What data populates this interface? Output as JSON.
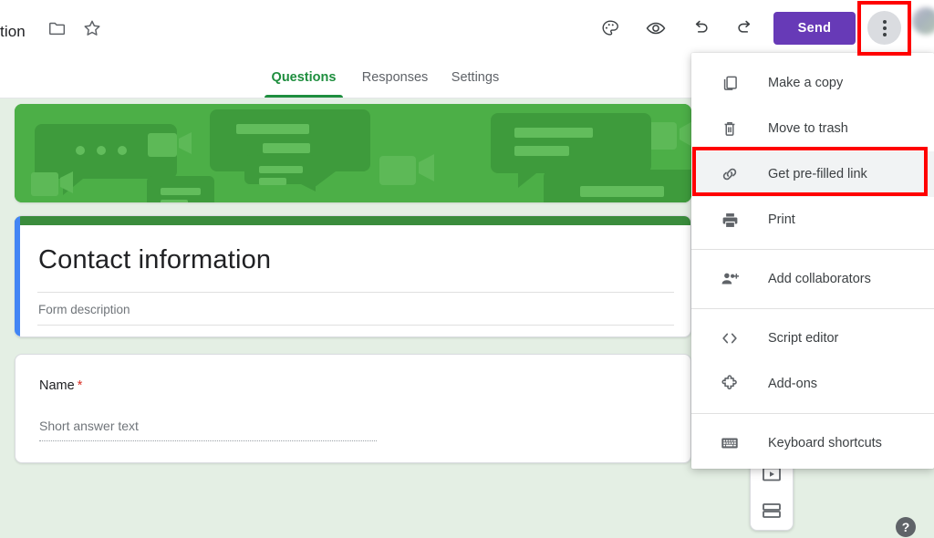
{
  "topbar": {
    "doc_title": "tion",
    "folder_icon": "folder-icon",
    "star_icon": "star-icon",
    "theme_icon": "palette-icon",
    "preview_icon": "eye-icon",
    "undo_icon": "undo-icon",
    "redo_icon": "redo-icon",
    "send_label": "Send",
    "more_icon": "more-vert-icon"
  },
  "tabs": [
    {
      "label": "Questions",
      "active": true
    },
    {
      "label": "Responses",
      "active": false
    },
    {
      "label": "Settings",
      "active": false
    }
  ],
  "form": {
    "title": "Contact information",
    "description_placeholder": "Form description",
    "question": {
      "label": "Name",
      "required_marker": "*",
      "answer_placeholder": "Short answer text"
    }
  },
  "side_toolbar": [
    {
      "icon": "add-video-icon"
    },
    {
      "icon": "add-section-icon"
    }
  ],
  "help": {
    "label": "?"
  },
  "menu": {
    "items": [
      {
        "label": "Make a copy",
        "icon": "copy-icon",
        "highlighted": false,
        "separator_after": false
      },
      {
        "label": "Move to trash",
        "icon": "trash-icon",
        "highlighted": false,
        "separator_after": false
      },
      {
        "label": "Get pre-filled link",
        "icon": "link-icon",
        "highlighted": true,
        "separator_after": false
      },
      {
        "label": "Print",
        "icon": "printer-icon",
        "highlighted": false,
        "separator_after": true
      },
      {
        "label": "Add collaborators",
        "icon": "person-add-icon",
        "highlighted": false,
        "separator_after": true
      },
      {
        "label": "Script editor",
        "icon": "code-icon",
        "highlighted": false,
        "separator_after": false
      },
      {
        "label": "Add-ons",
        "icon": "puzzle-icon",
        "highlighted": false,
        "separator_after": true
      },
      {
        "label": "Keyboard shortcuts",
        "icon": "keyboard-icon",
        "highlighted": false,
        "separator_after": false
      }
    ]
  },
  "colors": {
    "accent_green": "#1E8E3E",
    "send_purple": "#673AB7",
    "banner_green": "#4CAF47",
    "page_background": "#E4EFE4",
    "highlight_red": "#FF0000",
    "required_red": "#d93025",
    "card_blue_accent": "#4285F4"
  }
}
